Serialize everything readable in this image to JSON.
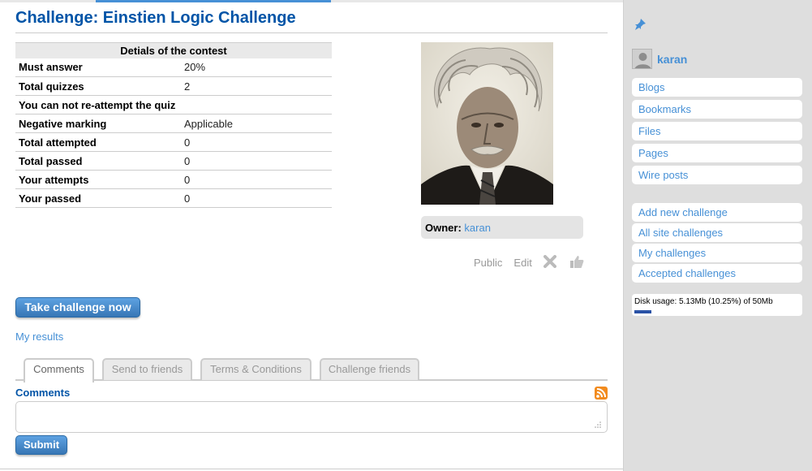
{
  "page": {
    "title": "Challenge: Einstien Logic Challenge"
  },
  "details": {
    "header": "Detials of the contest",
    "rows": [
      {
        "label": "Must answer",
        "value": "20%"
      },
      {
        "label": "Total quizzes",
        "value": "2"
      },
      {
        "label": "You can not re-attempt the quiz",
        "value": ""
      },
      {
        "label": "Negative marking",
        "value": "Applicable"
      },
      {
        "label": "Total attempted",
        "value": "0"
      },
      {
        "label": "Total passed",
        "value": "0"
      },
      {
        "label": "Your attempts",
        "value": "0"
      },
      {
        "label": "Your passed",
        "value": "0"
      }
    ]
  },
  "owner": {
    "label": "Owner:",
    "name": "karan"
  },
  "entity_menu": {
    "access": "Public",
    "edit": "Edit",
    "delete_icon": "close-x-icon",
    "like_icon": "thumbs-up-icon"
  },
  "actions": {
    "take_challenge": "Take challenge now",
    "my_results": "My results"
  },
  "tabs": [
    {
      "label": "Comments",
      "selected": true
    },
    {
      "label": "Send to friends",
      "selected": false
    },
    {
      "label": "Terms & Conditions",
      "selected": false
    },
    {
      "label": "Challenge friends",
      "selected": false
    }
  ],
  "comments": {
    "heading": "Comments",
    "input_value": "",
    "submit": "Submit",
    "rss_icon": "rss-icon"
  },
  "sidebar": {
    "pin_icon": "pin-icon",
    "owner_name": "karan",
    "menu": [
      "Blogs",
      "Bookmarks",
      "Files",
      "Pages",
      "Wire posts"
    ],
    "challenge_menu": [
      "Add new challenge",
      "All site challenges",
      "My challenges",
      "Accepted challenges"
    ],
    "disk_usage": "Disk usage: 5.13Mb (10.25%) of 50Mb",
    "disk_fraction": 0.1025
  },
  "colors": {
    "title": "#0054a7",
    "link": "#4690d6",
    "button": "#4690d6",
    "sidebar_bg": "#dedede",
    "rss": "#f28b1e"
  }
}
